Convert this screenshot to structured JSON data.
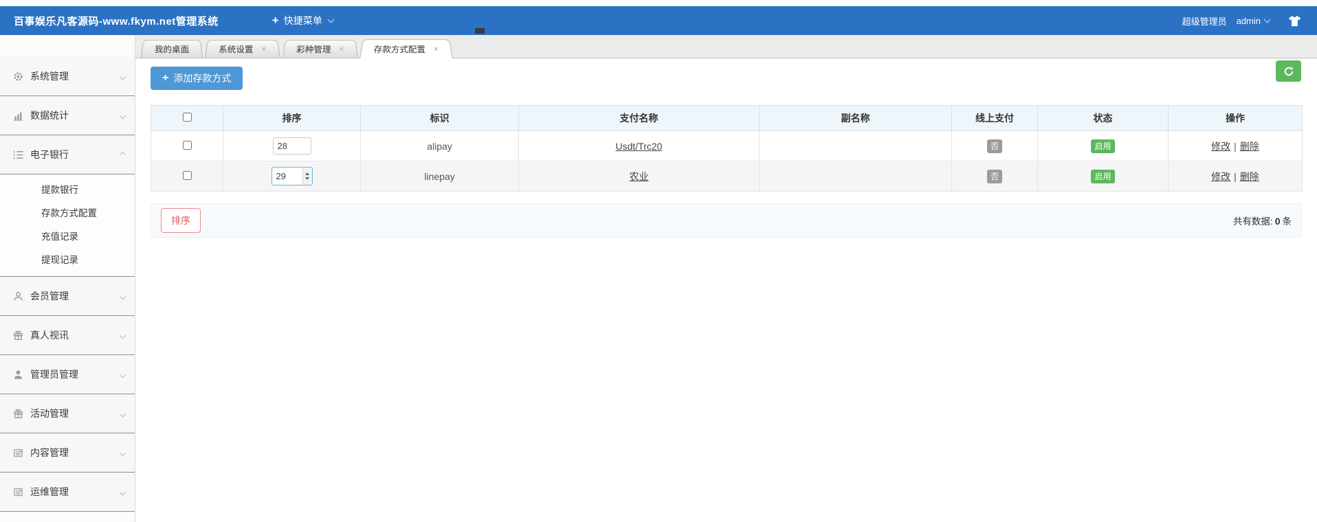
{
  "header": {
    "title": "百事娱乐凡客源码-www.fkym.net管理系统",
    "quick_menu_icon": "+",
    "quick_menu": "快捷菜单",
    "role": "超级管理员",
    "username": "admin"
  },
  "sidebar": {
    "groups": [
      {
        "label": "系统管理",
        "icon": "gear-icon"
      },
      {
        "label": "数据统计",
        "icon": "bar-chart-icon"
      },
      {
        "label": "电子银行",
        "icon": "ordered-list-icon",
        "expanded": true,
        "children": [
          "提款银行",
          "存款方式配置",
          "充值记录",
          "提现记录"
        ]
      },
      {
        "label": "会员管理",
        "icon": "user-outline-icon"
      },
      {
        "label": "真人视讯",
        "icon": "gift-icon"
      },
      {
        "label": "管理员管理",
        "icon": "user-filled-icon"
      },
      {
        "label": "活动管理",
        "icon": "gift-icon"
      },
      {
        "label": "内容管理",
        "icon": "news-icon"
      },
      {
        "label": "运维管理",
        "icon": "news-icon"
      }
    ]
  },
  "tabs": [
    {
      "label": "我的桌面",
      "closable": false,
      "active": false
    },
    {
      "label": "系统设置",
      "close": "×",
      "closable": true,
      "active": false
    },
    {
      "label": "彩种管理",
      "close": "×",
      "closable": true,
      "active": false
    },
    {
      "label": "存款方式配置",
      "close": "×",
      "closable": true,
      "active": true
    }
  ],
  "toolbar": {
    "add_icon": "+",
    "add_label": "添加存款方式"
  },
  "table": {
    "headers": [
      "排序",
      "标识",
      "支付名称",
      "副名称",
      "线上支付",
      "状态",
      "操作"
    ],
    "rows": [
      {
        "sort": "28",
        "code": "alipay",
        "pay_name": "Usdt/Trc20",
        "sub_name": "",
        "online": "否",
        "status": "启用",
        "action_edit": "修改",
        "action_sep": "|",
        "action_delete": "删除"
      },
      {
        "sort": "29",
        "code": "linepay",
        "pay_name": "农业",
        "sub_name": "",
        "online": "否",
        "status": "启用",
        "action_edit": "修改",
        "action_sep": "|",
        "action_delete": "删除"
      }
    ]
  },
  "footer": {
    "sort_button": "排序",
    "total_label": "共有数据:",
    "total_value": "0",
    "total_unit": "条"
  },
  "colors": {
    "header_blue": "#2b72c4",
    "add_button_blue": "#4f97d5",
    "success_green": "#5cb85c",
    "badge_gray": "#9b9b9b",
    "danger_red": "#e25a5a"
  }
}
